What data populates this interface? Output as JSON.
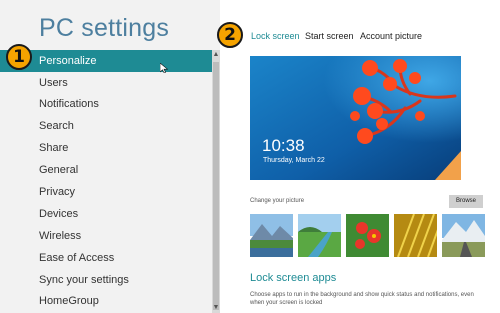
{
  "app": {
    "title": "PC settings"
  },
  "nav": {
    "items": [
      {
        "label": "Personalize"
      },
      {
        "label": "Users"
      },
      {
        "label": "Notifications"
      },
      {
        "label": "Search"
      },
      {
        "label": "Share"
      },
      {
        "label": "General"
      },
      {
        "label": "Privacy"
      },
      {
        "label": "Devices"
      },
      {
        "label": "Wireless"
      },
      {
        "label": "Ease of Access"
      },
      {
        "label": "Sync your settings"
      },
      {
        "label": "HomeGroup"
      }
    ],
    "selected": "Personalize"
  },
  "badges": {
    "one": "1",
    "two": "2"
  },
  "tabs": [
    {
      "label": "Lock screen"
    },
    {
      "label": "Start screen"
    },
    {
      "label": "Account picture"
    }
  ],
  "preview": {
    "time": "10:38",
    "date": "Thursday, March 22"
  },
  "picture": {
    "change_label": "Change your picture",
    "browse_label": "Browse"
  },
  "lock_apps": {
    "title": "Lock screen apps",
    "description": "Choose apps to run in the background and show quick status and notifications, even when your screen is locked"
  },
  "colors": {
    "accent": "#1e8b94",
    "title": "#4d7f9f",
    "badge": "#f5a300"
  }
}
